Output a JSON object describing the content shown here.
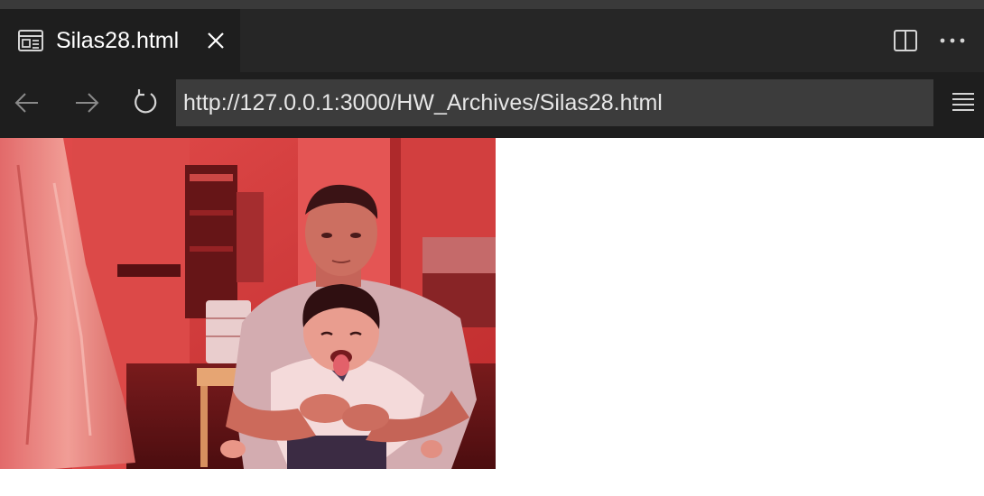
{
  "tab": {
    "title": "Silas28.html",
    "icon": "preview-page-icon",
    "close_icon": "close-icon"
  },
  "tab_actions": {
    "split_icon": "split-editor-icon",
    "more_icon": "more-actions-icon"
  },
  "toolbar": {
    "back_icon": "back-arrow-icon",
    "forward_icon": "forward-arrow-icon",
    "reload_icon": "reload-icon",
    "url": "http://127.0.0.1:3000/HW_Archives/Silas28.html",
    "menu_icon": "hamburger-menu-icon"
  },
  "page": {
    "image_subject": "man holding a toddler sticking out tongue in red-lit room"
  },
  "colors": {
    "tabbar_bg": "#262626",
    "active_tab_bg": "#1e1e1e",
    "toolbar_bg": "#1e1e1e",
    "url_field_bg": "#3c3c3c",
    "text": "#ffffff",
    "disabled_icon": "#8a8a8a",
    "page_bg": "#ffffff"
  }
}
